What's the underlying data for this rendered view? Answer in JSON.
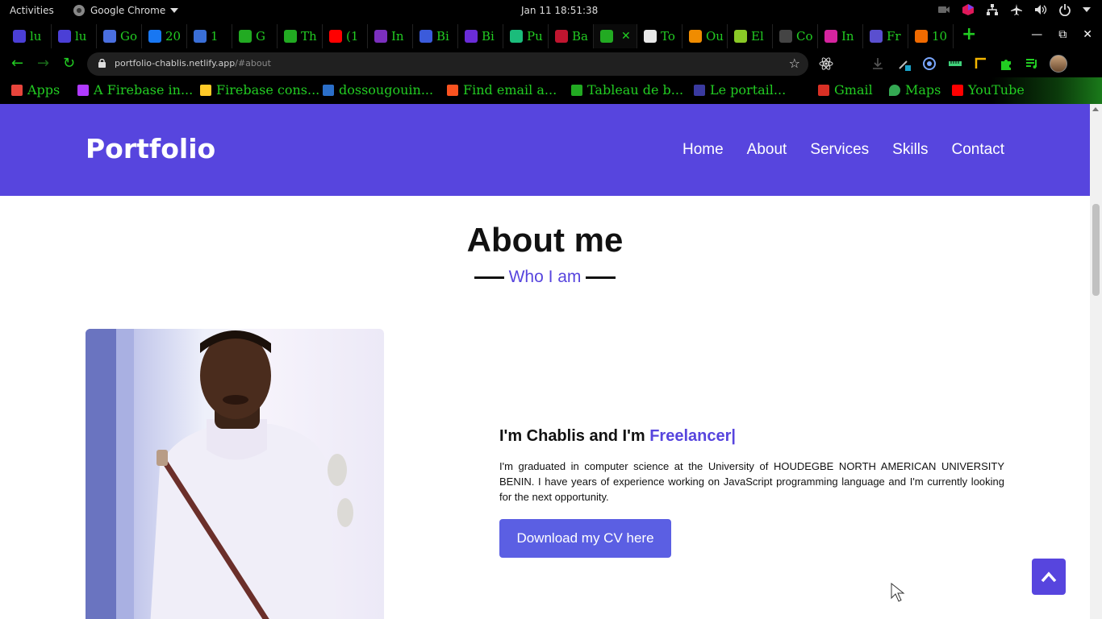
{
  "topbar": {
    "activities": "Activities",
    "app_name": "Google Chrome",
    "clock": "Jan 11  18:51:38"
  },
  "tabs": [
    {
      "label": "lu",
      "icon": "notes-icon",
      "color": "#4b3fd6"
    },
    {
      "label": "lu",
      "icon": "notes-icon",
      "color": "#4b3fd6"
    },
    {
      "label": "Go",
      "icon": "translate-icon",
      "color": "#4a6fe0"
    },
    {
      "label": "20",
      "icon": "facebook-icon",
      "color": "#1877f2"
    },
    {
      "label": "1",
      "icon": "inbox-icon",
      "color": "#3a6fd8"
    },
    {
      "label": "G",
      "icon": "globe-icon",
      "color": "#22aa22"
    },
    {
      "label": "Th",
      "icon": "globe-icon",
      "color": "#22aa22"
    },
    {
      "label": "(1",
      "icon": "youtube-icon",
      "color": "#ff0000"
    },
    {
      "label": "In",
      "icon": "b-icon",
      "color": "#7b2fbe"
    },
    {
      "label": "Bi",
      "icon": "flag-icon",
      "color": "#3b5bdb"
    },
    {
      "label": "Bi",
      "icon": "f-icon",
      "color": "#6a2cd8"
    },
    {
      "label": "Pu",
      "icon": "px-icon",
      "color": "#1bbc7b"
    },
    {
      "label": "Ba",
      "icon": "f-book-icon",
      "color": "#c0152f"
    },
    {
      "label": "",
      "icon": "globe-icon",
      "color": "#22aa22",
      "active": true
    },
    {
      "label": "To",
      "icon": "chrome-icon",
      "color": "#e8e8e8"
    },
    {
      "label": "Ou",
      "icon": "r-icon",
      "color": "#f08c00"
    },
    {
      "label": "El",
      "icon": "envelope-icon",
      "color": "#8ac926"
    },
    {
      "label": "Co",
      "icon": "ball-icon",
      "color": "#444444"
    },
    {
      "label": "In",
      "icon": "instagram-icon",
      "color": "#d6249f"
    },
    {
      "label": "Fr",
      "icon": "c-icon",
      "color": "#5a4fcf"
    },
    {
      "label": "10",
      "icon": "gb-icon",
      "color": "#f06a00"
    }
  ],
  "address_bar": {
    "host": "portfolio-chablis.netlify.app",
    "path": "/#about"
  },
  "bookmarks": [
    {
      "label": "Apps",
      "icon": "apps-grid-icon"
    },
    {
      "label": "A Firebase in...",
      "icon": "info-icon"
    },
    {
      "label": "Firebase cons...",
      "icon": "firebase-icon"
    },
    {
      "label": "dossougouin...",
      "icon": "linkedin-icon"
    },
    {
      "label": "Find email a...",
      "icon": "hunter-icon"
    },
    {
      "label": "Tableau de b...",
      "icon": "globe-icon"
    },
    {
      "label": "Le portail...",
      "icon": "portal-icon"
    },
    {
      "label": "Gmail",
      "icon": "gmail-icon"
    },
    {
      "label": "Maps",
      "icon": "maps-pin-icon"
    },
    {
      "label": "YouTube",
      "icon": "youtube-icon"
    }
  ],
  "site": {
    "brand": "Portfolio",
    "nav": [
      "Home",
      "About",
      "Services",
      "Skills",
      "Contact"
    ],
    "accent": "#5745de",
    "about": {
      "title": "About me",
      "subtitle": "Who I am",
      "intro_prefix": "I'm Chablis and I'm ",
      "intro_role": "Freelancer",
      "bio": "I'm graduated in computer science at the University of HOUDEGBE NORTH AMERICAN UNIVERSITY BENIN. I have years of experience working on JavaScript programming language and I'm currently looking for the next opportunity.",
      "cv_button": "Download my CV here"
    }
  }
}
